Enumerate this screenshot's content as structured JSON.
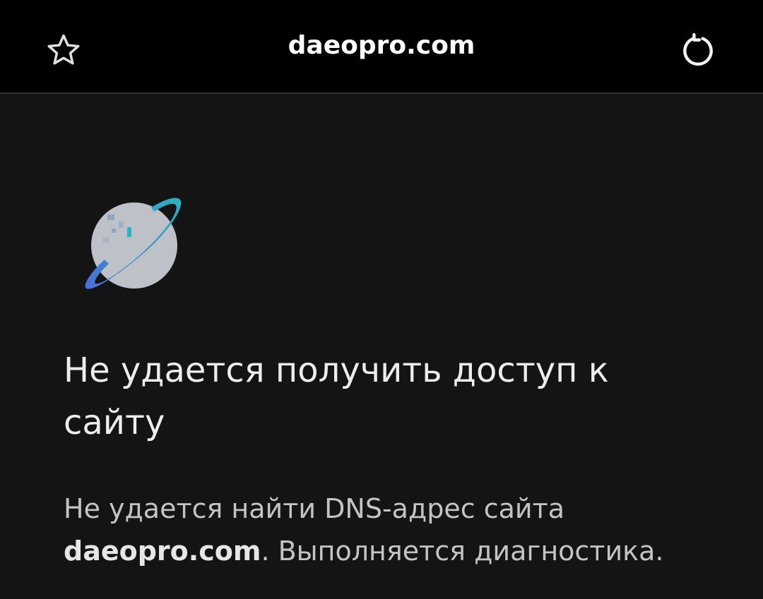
{
  "topbar": {
    "bookmark_icon": "star-outline-icon",
    "url_text": "daeopro.com",
    "reload_icon": "reload-icon"
  },
  "error": {
    "icon": "dino-planet-icon",
    "title": "Не удается получить доступ к сайту",
    "desc_before": "Не удается найти DNS-адрес сайта ",
    "desc_domain": "daeopro.com",
    "desc_after": ". Выполняется диагностика."
  },
  "colors": {
    "background": "#141414",
    "topbar": "#000000",
    "title_text": "#ededed",
    "body_text": "#c4c4c4",
    "icon_teal": "#2ab3c0",
    "icon_blue": "#4a6fd8",
    "icon_planet": "#bfc1c8"
  }
}
